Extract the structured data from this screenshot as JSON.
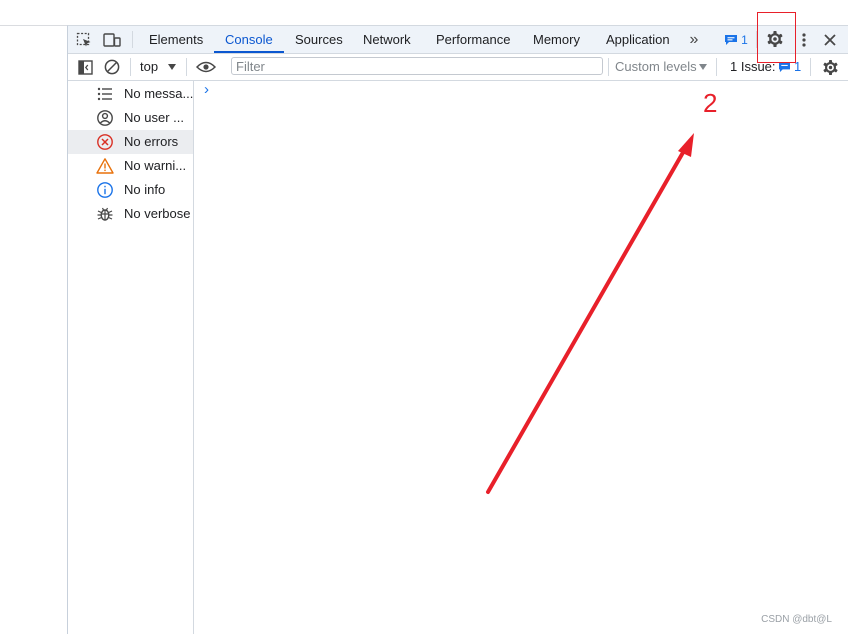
{
  "tabs": [
    {
      "label": "Elements",
      "active": false
    },
    {
      "label": "Console",
      "active": true
    },
    {
      "label": "Sources",
      "active": false
    },
    {
      "label": "Network",
      "active": false
    },
    {
      "label": "Performance",
      "active": false
    },
    {
      "label": "Memory",
      "active": false
    },
    {
      "label": "Application",
      "active": false
    }
  ],
  "tabbar": {
    "more_tabs_glyph": "»",
    "messages_count": "1"
  },
  "toolbar": {
    "context": "top",
    "filter_placeholder": "Filter",
    "filter_value": "",
    "levels_label": "Custom levels",
    "issues_label": "1 Issue:",
    "issues_count": "1"
  },
  "sidebar": {
    "items": [
      {
        "label": "No messa...",
        "icon": "list-icon"
      },
      {
        "label": "No user ...",
        "icon": "user-icon"
      },
      {
        "label": "No errors",
        "icon": "error-icon"
      },
      {
        "label": "No warni...",
        "icon": "warning-icon"
      },
      {
        "label": "No info",
        "icon": "info-icon"
      },
      {
        "label": "No verbose",
        "icon": "bug-icon"
      }
    ],
    "selected_index": 2
  },
  "console": {
    "prompt_glyph": "›"
  },
  "annotation": {
    "number": "2",
    "color": "#e8202a"
  },
  "watermark": "CSDN @dbt@L",
  "colors": {
    "accent": "#0b57d0",
    "error": "#d93025",
    "warning": "#e8710a",
    "info": "#1a73e8",
    "annotation": "#e8202a"
  }
}
